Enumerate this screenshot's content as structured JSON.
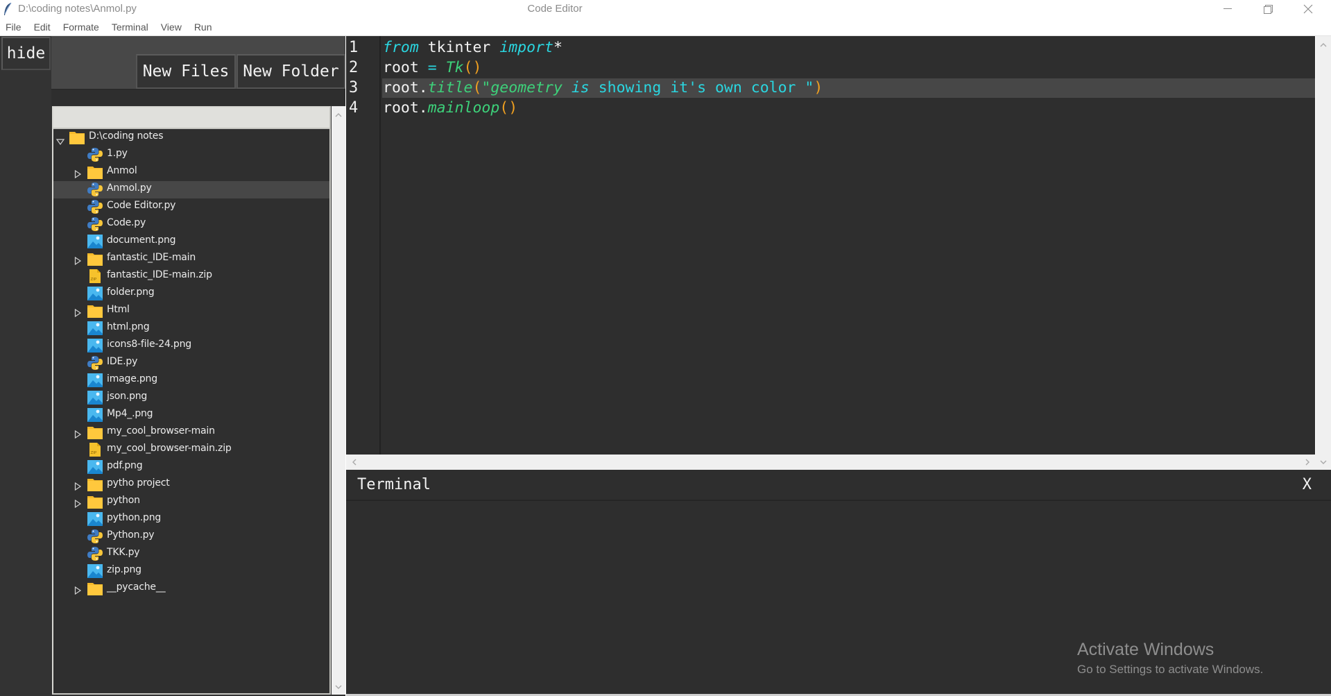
{
  "window": {
    "path": "D:\\coding notes\\Anmol.py",
    "title": "Code Editor",
    "controls": [
      "minimize",
      "restore",
      "close"
    ]
  },
  "menu": [
    {
      "label": "File"
    },
    {
      "label": "Edit"
    },
    {
      "label": "Formate"
    },
    {
      "label": "Terminal"
    },
    {
      "label": "View"
    },
    {
      "label": "Run"
    }
  ],
  "sidebar": {
    "hide_label": "hide",
    "new_files_label": "New Files",
    "new_folder_label": "New Folder"
  },
  "tree": {
    "root": {
      "label": "D:\\coding notes",
      "type": "folder",
      "expanded": true
    },
    "items": [
      {
        "label": "1.py",
        "type": "python"
      },
      {
        "label": "Anmol",
        "type": "folder",
        "expanded": false
      },
      {
        "label": "Anmol.py",
        "type": "python",
        "selected": true
      },
      {
        "label": "Code Editor.py",
        "type": "python"
      },
      {
        "label": "Code.py",
        "type": "python"
      },
      {
        "label": "document.png",
        "type": "image"
      },
      {
        "label": "fantastic_IDE-main",
        "type": "folder",
        "expanded": false
      },
      {
        "label": "fantastic_IDE-main.zip",
        "type": "zip"
      },
      {
        "label": "folder.png",
        "type": "image"
      },
      {
        "label": "Html",
        "type": "folder",
        "expanded": false
      },
      {
        "label": "html.png",
        "type": "image"
      },
      {
        "label": "icons8-file-24.png",
        "type": "image"
      },
      {
        "label": "IDE.py",
        "type": "python"
      },
      {
        "label": "image.png",
        "type": "image"
      },
      {
        "label": "json.png",
        "type": "image"
      },
      {
        "label": "Mp4_.png",
        "type": "image"
      },
      {
        "label": "my_cool_browser-main",
        "type": "folder",
        "expanded": false
      },
      {
        "label": "my_cool_browser-main.zip",
        "type": "zip"
      },
      {
        "label": "pdf.png",
        "type": "image"
      },
      {
        "label": "pytho project",
        "type": "folder",
        "expanded": false
      },
      {
        "label": "python",
        "type": "folder",
        "expanded": false
      },
      {
        "label": "python.png",
        "type": "image"
      },
      {
        "label": "Python.py",
        "type": "python"
      },
      {
        "label": "TKK.py",
        "type": "python"
      },
      {
        "label": "zip.png",
        "type": "image"
      },
      {
        "label": "__pycache__",
        "type": "folder",
        "expanded": false
      }
    ]
  },
  "editor": {
    "current_line": 3,
    "lines": [
      {
        "number": "1",
        "tokens": [
          {
            "t": "from",
            "k": "kw"
          },
          {
            "t": " tkinter ",
            "k": "plain"
          },
          {
            "t": "import",
            "k": "kw"
          },
          {
            "t": "*",
            "k": "plain"
          }
        ]
      },
      {
        "number": "2",
        "tokens": [
          {
            "t": "root ",
            "k": "plain"
          },
          {
            "t": "=",
            "k": "op"
          },
          {
            "t": " ",
            "k": "plain"
          },
          {
            "t": "Tk",
            "k": "fn"
          },
          {
            "t": "()",
            "k": "paren"
          }
        ]
      },
      {
        "number": "3",
        "tokens": [
          {
            "t": "root.",
            "k": "plain"
          },
          {
            "t": "title",
            "k": "fn"
          },
          {
            "t": "(",
            "k": "paren"
          },
          {
            "t": "\"geometry",
            "k": "str-it"
          },
          {
            "t": " is",
            "k": "str-it2"
          },
          {
            "t": " showing it's own color \"",
            "k": "str"
          },
          {
            "t": ")",
            "k": "paren"
          }
        ]
      },
      {
        "number": "4",
        "tokens": [
          {
            "t": "root.",
            "k": "plain"
          },
          {
            "t": "mainloop",
            "k": "fn"
          },
          {
            "t": "()",
            "k": "paren"
          }
        ]
      }
    ]
  },
  "terminal": {
    "title": "Terminal",
    "close_label": "X",
    "output": ""
  },
  "watermark": {
    "title": "Activate Windows",
    "subtitle": "Go to Settings to activate Windows."
  },
  "colors": {
    "keyword": "#2ad6e0",
    "function": "#3dd17a",
    "paren": "#f0a020",
    "editor_bg": "#2e2e2e",
    "current_line_bg": "#474747"
  }
}
